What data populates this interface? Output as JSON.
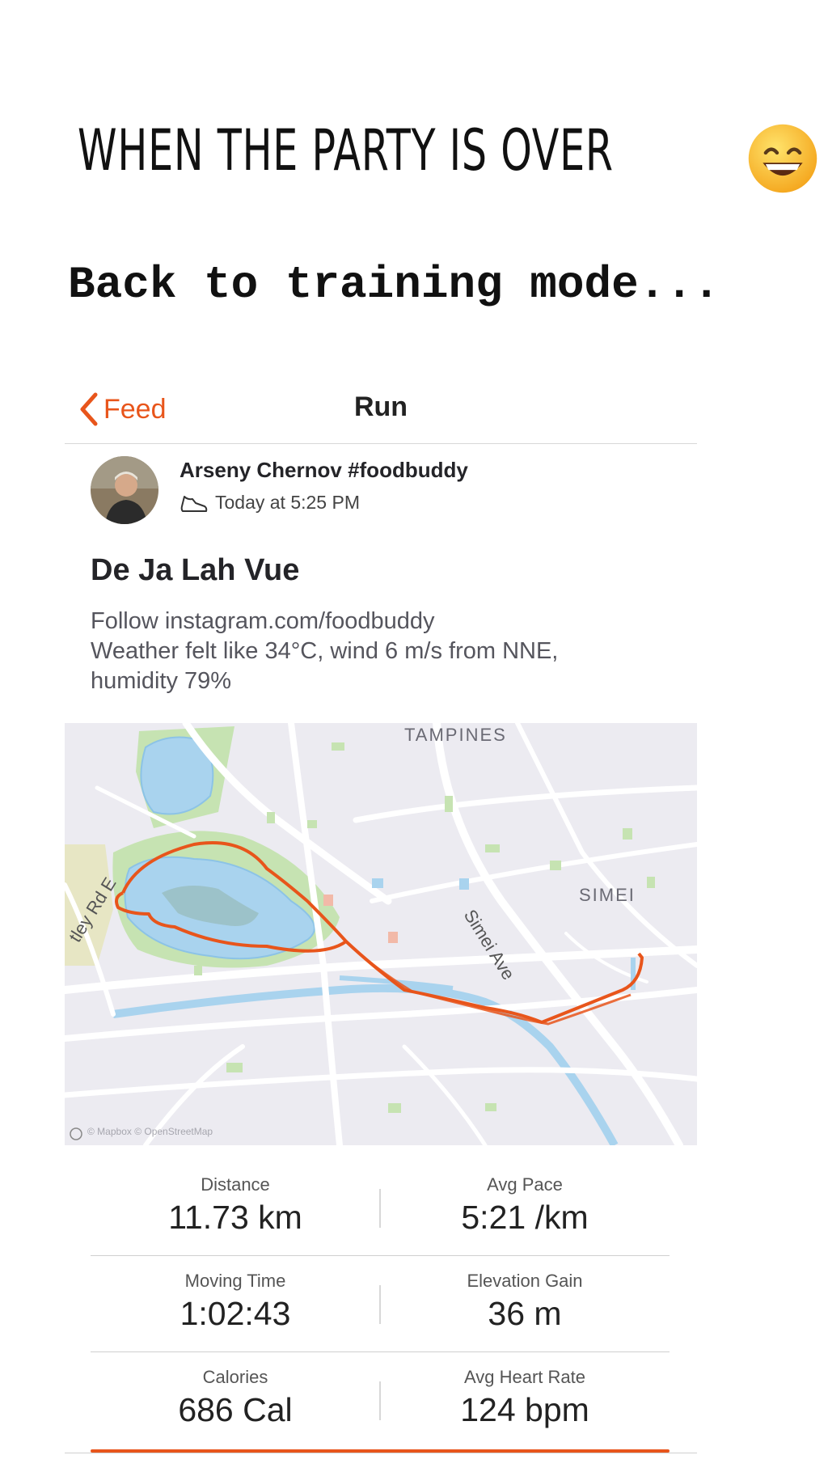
{
  "story": {
    "caption_title": "WHEN THE PARTY IS OVER",
    "caption_subtitle": "Back to training mode..."
  },
  "navbar": {
    "back_label": "Feed",
    "title": "Run"
  },
  "activity": {
    "athlete": "Arseny Chernov #foodbuddy",
    "timestamp": "Today at 5:25 PM",
    "title": "De Ja Lah Vue",
    "description": [
      "Follow instagram.com/foodbuddy",
      "Weather felt like 34°C, wind 6 m/s from NNE,",
      "humidity 79%"
    ]
  },
  "map": {
    "labels": {
      "tampines": "TAMPINES",
      "simei": "SIMEI",
      "simei_ave": "Simei Ave",
      "road": "tley Rd E"
    },
    "attribution": "© Mapbox © OpenStreetMap",
    "route_color": "#e8551b"
  },
  "stats": [
    {
      "label": "Distance",
      "value": "11.73 km"
    },
    {
      "label": "Avg Pace",
      "value": "5:21 /km"
    },
    {
      "label": "Moving Time",
      "value": "1:02:43"
    },
    {
      "label": "Elevation Gain",
      "value": "36 m"
    },
    {
      "label": "Calories",
      "value": "686 Cal"
    },
    {
      "label": "Avg Heart Rate",
      "value": "124 bpm"
    }
  ],
  "colors": {
    "accent": "#e8551b",
    "map_water": "#a9d3ee",
    "map_park": "#b7dca0",
    "map_bg": "#ecebf1"
  }
}
